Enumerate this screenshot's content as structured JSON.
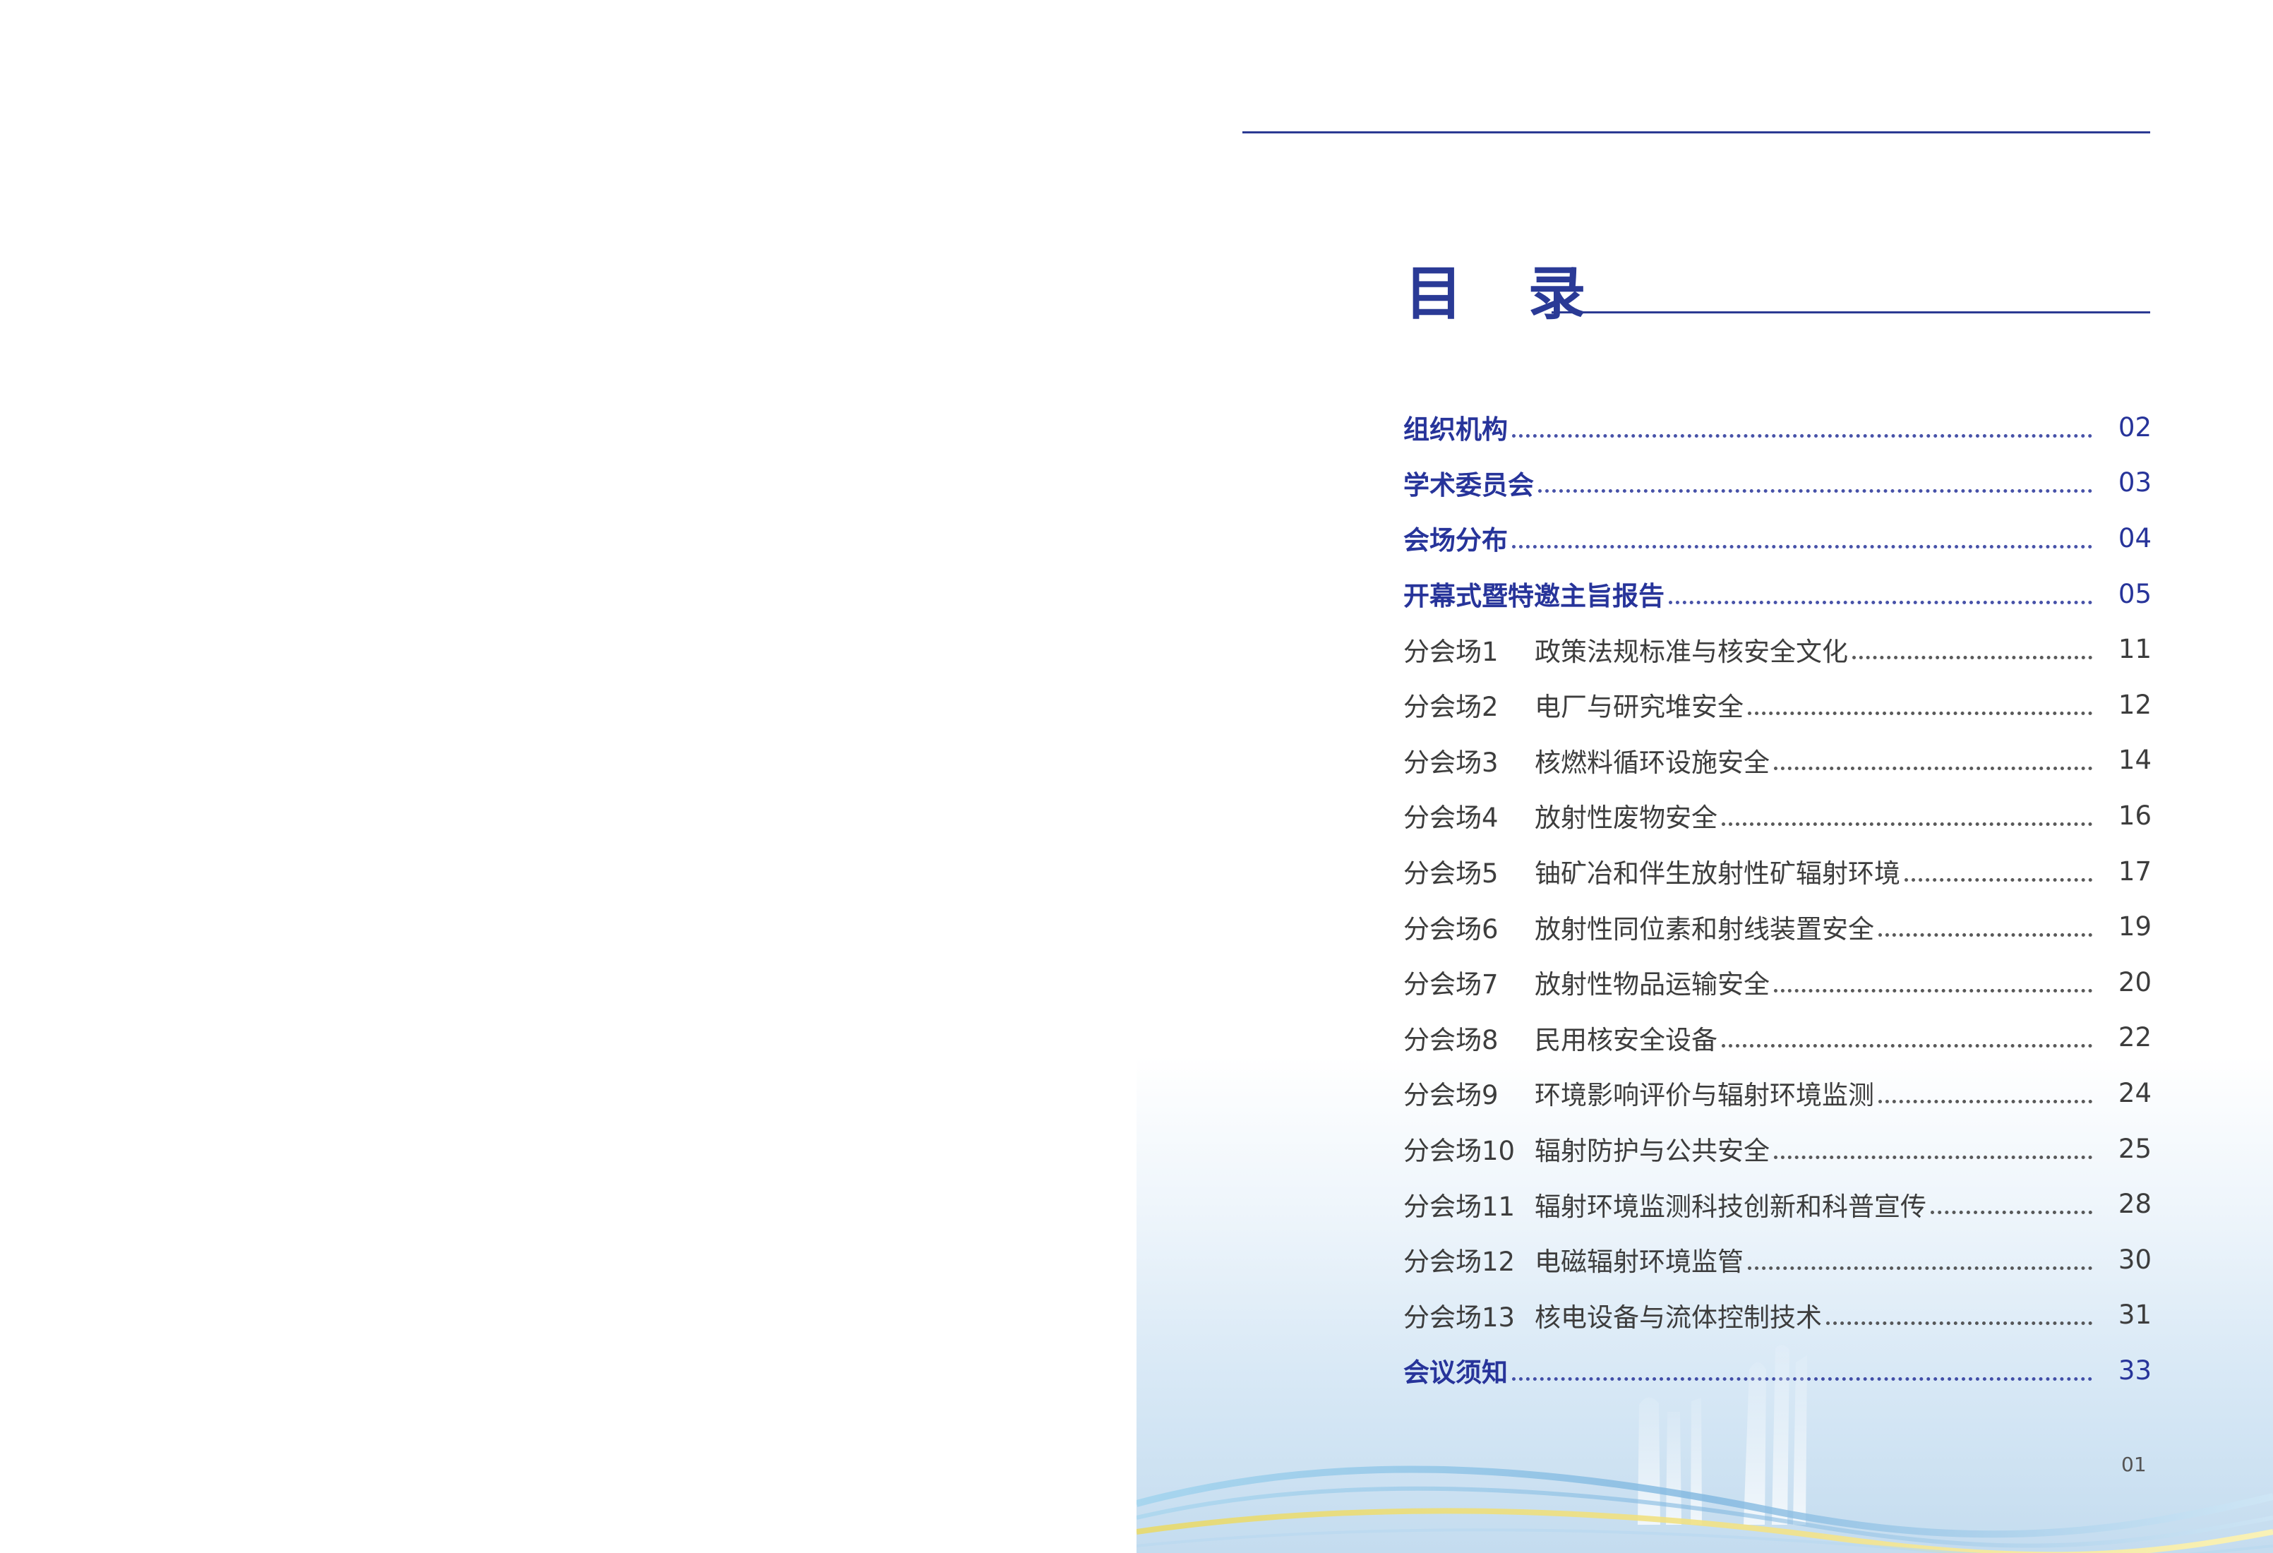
{
  "toc": {
    "title": "目 录",
    "items": [
      {
        "session": "",
        "label": "组织机构",
        "page": "02",
        "bold": true
      },
      {
        "session": "",
        "label": "学术委员会",
        "page": "03",
        "bold": true
      },
      {
        "session": "",
        "label": "会场分布",
        "page": "04",
        "bold": true
      },
      {
        "session": "",
        "label": "开幕式暨特邀主旨报告",
        "page": "05",
        "bold": true
      },
      {
        "session": "分会场1",
        "label": "政策法规标准与核安全文化",
        "page": "11",
        "bold": false
      },
      {
        "session": "分会场2",
        "label": "电厂与研究堆安全",
        "page": "12",
        "bold": false
      },
      {
        "session": "分会场3",
        "label": "核燃料循环设施安全",
        "page": "14",
        "bold": false
      },
      {
        "session": "分会场4",
        "label": "放射性废物安全",
        "page": "16",
        "bold": false
      },
      {
        "session": "分会场5",
        "label": "铀矿冶和伴生放射性矿辐射环境",
        "page": "17",
        "bold": false
      },
      {
        "session": "分会场6",
        "label": "放射性同位素和射线装置安全",
        "page": "19",
        "bold": false
      },
      {
        "session": "分会场7",
        "label": "放射性物品运输安全",
        "page": "20",
        "bold": false
      },
      {
        "session": "分会场8",
        "label": "民用核安全设备",
        "page": "22",
        "bold": false
      },
      {
        "session": "分会场9",
        "label": "环境影响评价与辐射环境监测",
        "page": "24",
        "bold": false
      },
      {
        "session": "分会场10",
        "label": "辐射防护与公共安全",
        "page": "25",
        "bold": false
      },
      {
        "session": "分会场11",
        "label": "辐射环境监测科技创新和科普宣传",
        "page": "28",
        "bold": false
      },
      {
        "session": "分会场12",
        "label": "电磁辐射环境监管",
        "page": "30",
        "bold": false
      },
      {
        "session": "分会场13",
        "label": "核电设备与流体控制技术",
        "page": "31",
        "bold": false
      },
      {
        "session": "",
        "label": "会议须知",
        "page": "33",
        "bold": true
      }
    ]
  },
  "page_number": "01",
  "colors": {
    "accent": "#2a3a96",
    "body_text": "#3d3d3d"
  }
}
